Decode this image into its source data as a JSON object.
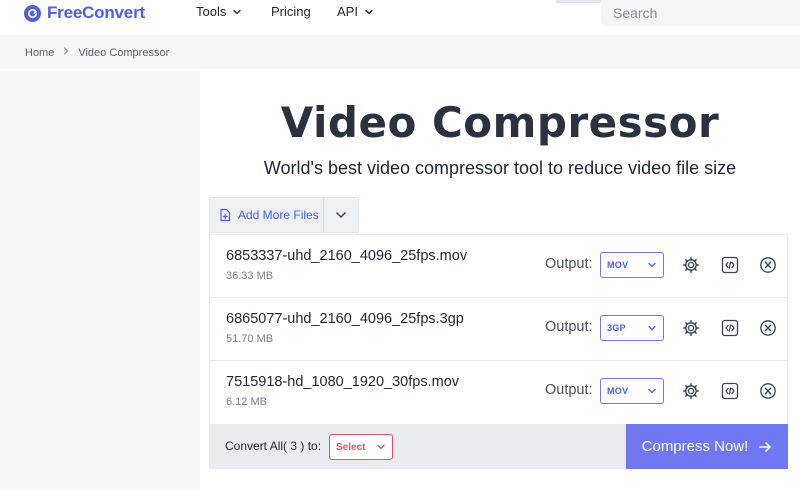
{
  "header": {
    "brand": "FreeConvert",
    "nav": [
      {
        "label": "Tools",
        "has_dropdown": true
      },
      {
        "label": "Pricing",
        "has_dropdown": false
      },
      {
        "label": "API",
        "has_dropdown": true
      }
    ],
    "search_placeholder": "Search"
  },
  "breadcrumb": {
    "items": [
      "Home",
      "Video Compressor"
    ]
  },
  "page": {
    "title": "Video Compressor",
    "subtitle": "World's best video compressor tool to reduce video file size"
  },
  "add_files": {
    "label": "Add More Files"
  },
  "files": [
    {
      "name": "6853337-uhd_2160_4096_25fps.mov",
      "size": "36.33 MB",
      "output_label": "Output:",
      "output_format": "MOV"
    },
    {
      "name": "6865077-uhd_2160_4096_25fps.3gp",
      "size": "51.70 MB",
      "output_label": "Output:",
      "output_format": "3GP"
    },
    {
      "name": "7515918-hd_1080_1920_30fps.mov",
      "size": "6.12 MB",
      "output_label": "Output:",
      "output_format": "MOV"
    }
  ],
  "bottom_bar": {
    "convert_all_label": "Convert All( 3 ) to:",
    "convert_all_value": "Select",
    "compress_button": "Compress Now!"
  },
  "colors": {
    "brand": "#4f5fe0",
    "compress_button": "#6f78f0",
    "select_warning": "#e0546a"
  },
  "icons": {
    "logo": "refresh-circle-icon",
    "dropdown": "chevron-down-icon",
    "add_file": "file-plus-icon",
    "settings": "gear-icon",
    "embed": "code-icon",
    "remove": "close-circle-icon",
    "compress": "arrow-right-icon"
  }
}
